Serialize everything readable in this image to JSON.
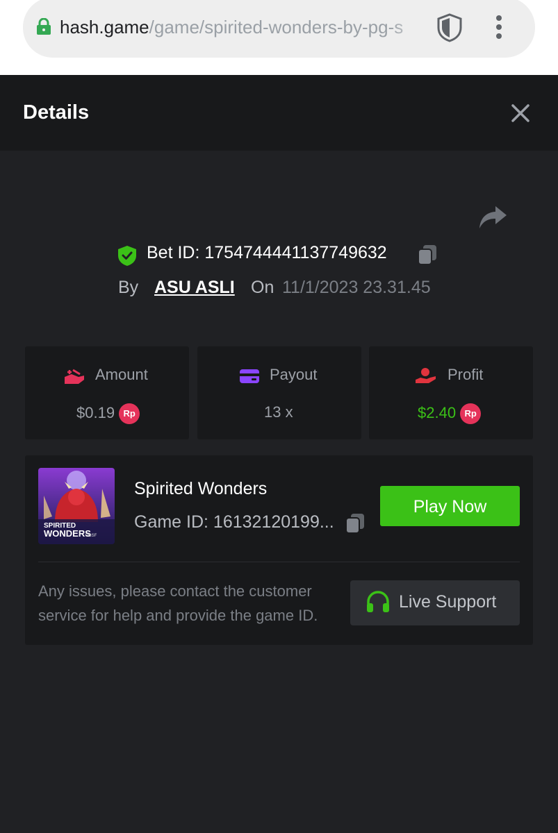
{
  "browser": {
    "url_host": "hash.game",
    "url_path": "/game/spirited-wonders-by-pg-s"
  },
  "modal": {
    "title": "Details"
  },
  "bet": {
    "id_label": "Bet ID: 1754744441137749632",
    "by_label": "By",
    "username": "ASU ASLI",
    "on_label": "On",
    "datetime": "11/1/2023 23.31.45"
  },
  "stats": {
    "amount": {
      "label": "Amount",
      "value": "$0.19",
      "currency_badge": "Rp"
    },
    "payout": {
      "label": "Payout",
      "value": "13 x"
    },
    "profit": {
      "label": "Profit",
      "value": "$2.40",
      "currency_badge": "Rp"
    }
  },
  "game": {
    "name": "Spirited Wonders",
    "id_label": "Game ID: 16132120199...",
    "thumb_text_line1": "SPIRITED",
    "thumb_text_line2": "WONDERS",
    "thumb_brand": "PGSF",
    "play_label": "Play Now"
  },
  "support": {
    "help_text": "Any issues, please contact the customer service for help and provide the game ID.",
    "button_label": "Live Support"
  },
  "colors": {
    "accent_green": "#3bc117",
    "profit_green": "#3bc117",
    "badge_red": "#e5335a",
    "amount_icon": "#e5335a",
    "payout_icon": "#8b45ff",
    "profit_icon": "#e0343e"
  },
  "icons": {
    "lock": "lock-icon",
    "shield": "shield-icon",
    "menu": "kebab-menu-icon",
    "close": "close-icon",
    "share": "share-icon",
    "verified": "verified-shield-icon",
    "copy": "copy-icon",
    "headset": "headset-icon"
  }
}
